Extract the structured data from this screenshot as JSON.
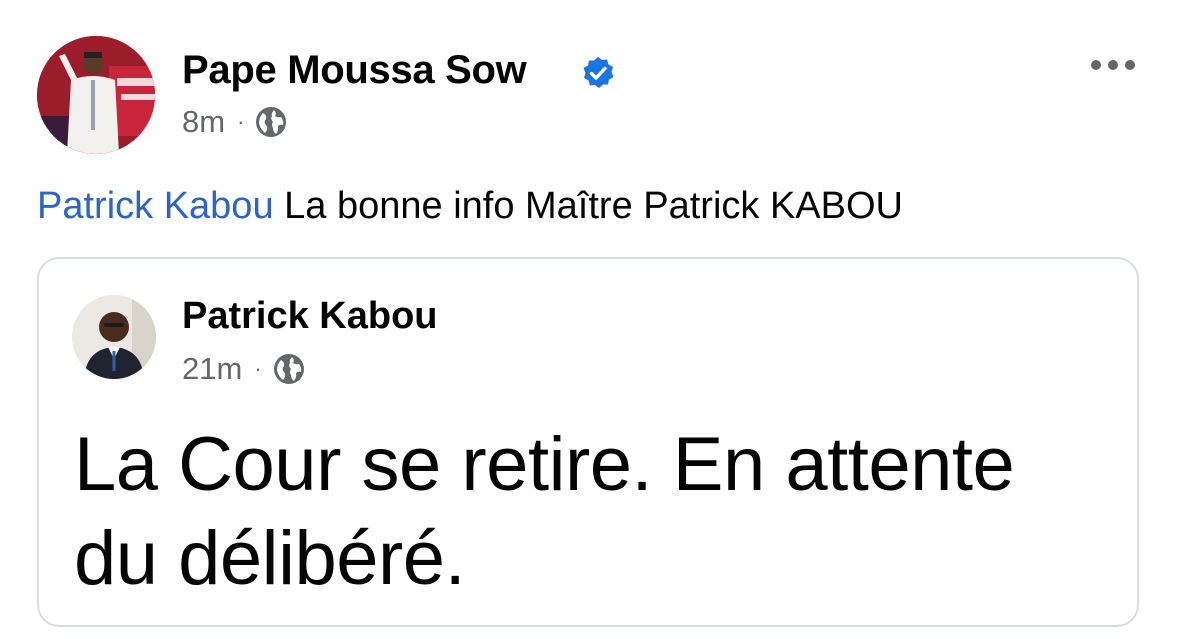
{
  "post": {
    "author": "Pape Moussa Sow",
    "verified": true,
    "time": "8m",
    "separator": "·",
    "audience_icon": "globe-icon",
    "more_icon": "more-dots-icon",
    "mention": "Patrick Kabou",
    "text": "La bonne info Maître Patrick KABOU"
  },
  "shared_post": {
    "author": "Patrick Kabou",
    "time": "21m",
    "separator": "·",
    "audience_icon": "globe-icon",
    "text": "La Cour se retire. En attente du délibéré."
  },
  "colors": {
    "mention": "#2d64c8",
    "verified_badge": "#1b74e4",
    "meta_text": "#65676b",
    "card_border": "#dadde1"
  }
}
